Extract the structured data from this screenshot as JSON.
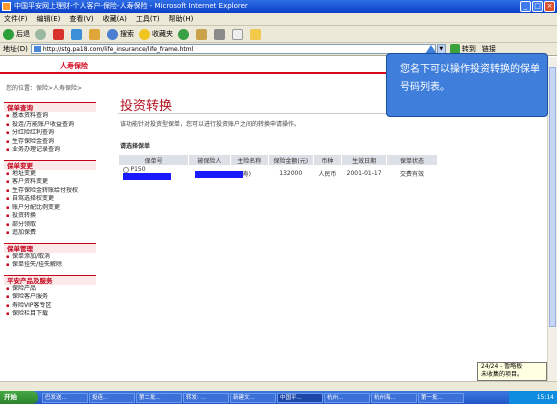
{
  "window": {
    "title": "中国平安网上理财-个人客户-保险-人寿保险 - Microsoft Internet Explorer"
  },
  "menubar": [
    "文件(F)",
    "编辑(E)",
    "查看(V)",
    "收藏(A)",
    "工具(T)",
    "帮助(H)"
  ],
  "toolbar": {
    "back": "后退",
    "search": "搜索",
    "favorites": "收藏夹"
  },
  "address": {
    "label": "地址(D)",
    "url": "http://stg.pa18.com/life_insurance/life_frame.html",
    "go": "转到",
    "links": "链接"
  },
  "page": {
    "tab": "人寿保险",
    "breadcrumb": "您的位置：保险>人寿保险>",
    "title": "投资转换",
    "description": "该功能针对投资型保单，您可以进行投资账户之间的转换申请操作。",
    "select_label": "请选择保单"
  },
  "sidebar": [
    {
      "heading": "保单查询",
      "items": [
        "基本资料查询",
        "投连/万能账户收益查询",
        "分红险红利查询",
        "生存保险金查询",
        "业务办理记录查询"
      ]
    },
    {
      "heading": "保单变更",
      "items": [
        "地址变更",
        "客户资料变更",
        "生存保险金转账给付授权",
        "自驾选择权变更",
        "账户分配比例变更",
        "投资转换",
        "部分领取",
        "追加保费"
      ]
    },
    {
      "heading": "保单管理",
      "items": [
        "保单添加/取消",
        "保单挂失/挂失解除"
      ]
    },
    {
      "heading": "平安产品及服务",
      "items": [
        "保险产品",
        "保险客户服务",
        "寿险VIP客专区",
        "保险栏目下载"
      ]
    }
  ],
  "table": {
    "headers": [
      "保单号",
      "被保险人",
      "主险名称",
      "保险金额(元)",
      "币种",
      "生效日期",
      "保单状态"
    ],
    "rows": [
      {
        "policy_prefix": "P150",
        "insured_suffix": "",
        "product_suffix": "寿)",
        "amount": "132000",
        "currency": "人民币",
        "date": "2001-01-17",
        "status": "交费有效"
      }
    ]
  },
  "callout": {
    "text": "您名下可以操作投资转换的保单号码列表。"
  },
  "tooltip": {
    "line1": "24/24 - 暂略板",
    "line2": "未收集的项目。"
  },
  "taskbar": {
    "start": "开始",
    "tasks": [
      "巴发送...",
      "投连...",
      "第二批...",
      "转发: ...",
      "新建文...",
      "中国平...",
      "杭州...",
      "杭州海...",
      "第一批..."
    ],
    "clock": "15:14"
  },
  "colors": {
    "brand_red": "#d6081f",
    "callout_blue": "#3f7fdb",
    "mask_blue": "#1a1aff"
  }
}
